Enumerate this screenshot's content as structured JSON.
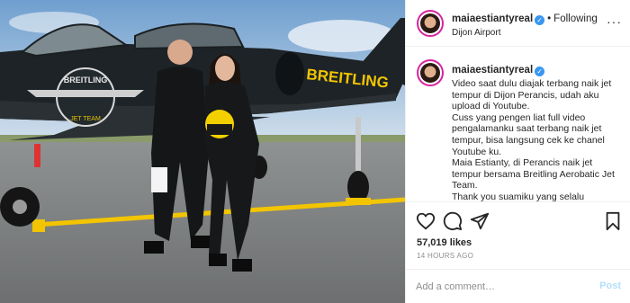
{
  "post": {
    "username": "maiaestiantyreal",
    "follow_status": "Following",
    "location": "Dijon Airport",
    "caption": "Video saat dulu diajak terbang naik jet tempur di Dijon Perancis, udah aku upload di Youtube.\nCuss yang pengen liat full video pengalamanku saat terbang naik jet tempur, bisa langsung cek ke chanel Youtube ku.\nMaia Estianty, di Perancis naik jet tempur bersama Breitling Aerobatic Jet Team.\nThank you suamiku yang selalu",
    "likes": "57,019 likes",
    "time_ago": "14 HOURS AGO"
  },
  "image": {
    "jet_brand": "BREITLING",
    "logo_text": "BREITLING",
    "logo_subtext": "JET TEAM"
  },
  "comment": {
    "placeholder": "Add a comment…",
    "post_label": "Post"
  },
  "icons": {
    "verified": "verified-badge-icon",
    "more": "more-options-icon",
    "like": "heart-icon",
    "comment": "comment-bubble-icon",
    "share": "paper-plane-icon",
    "save": "bookmark-icon"
  },
  "colors": {
    "accent": "#3897f0",
    "post_disabled": "#b2dffc",
    "muted": "#8e8e8e",
    "jet_yellow": "#f2c500"
  }
}
